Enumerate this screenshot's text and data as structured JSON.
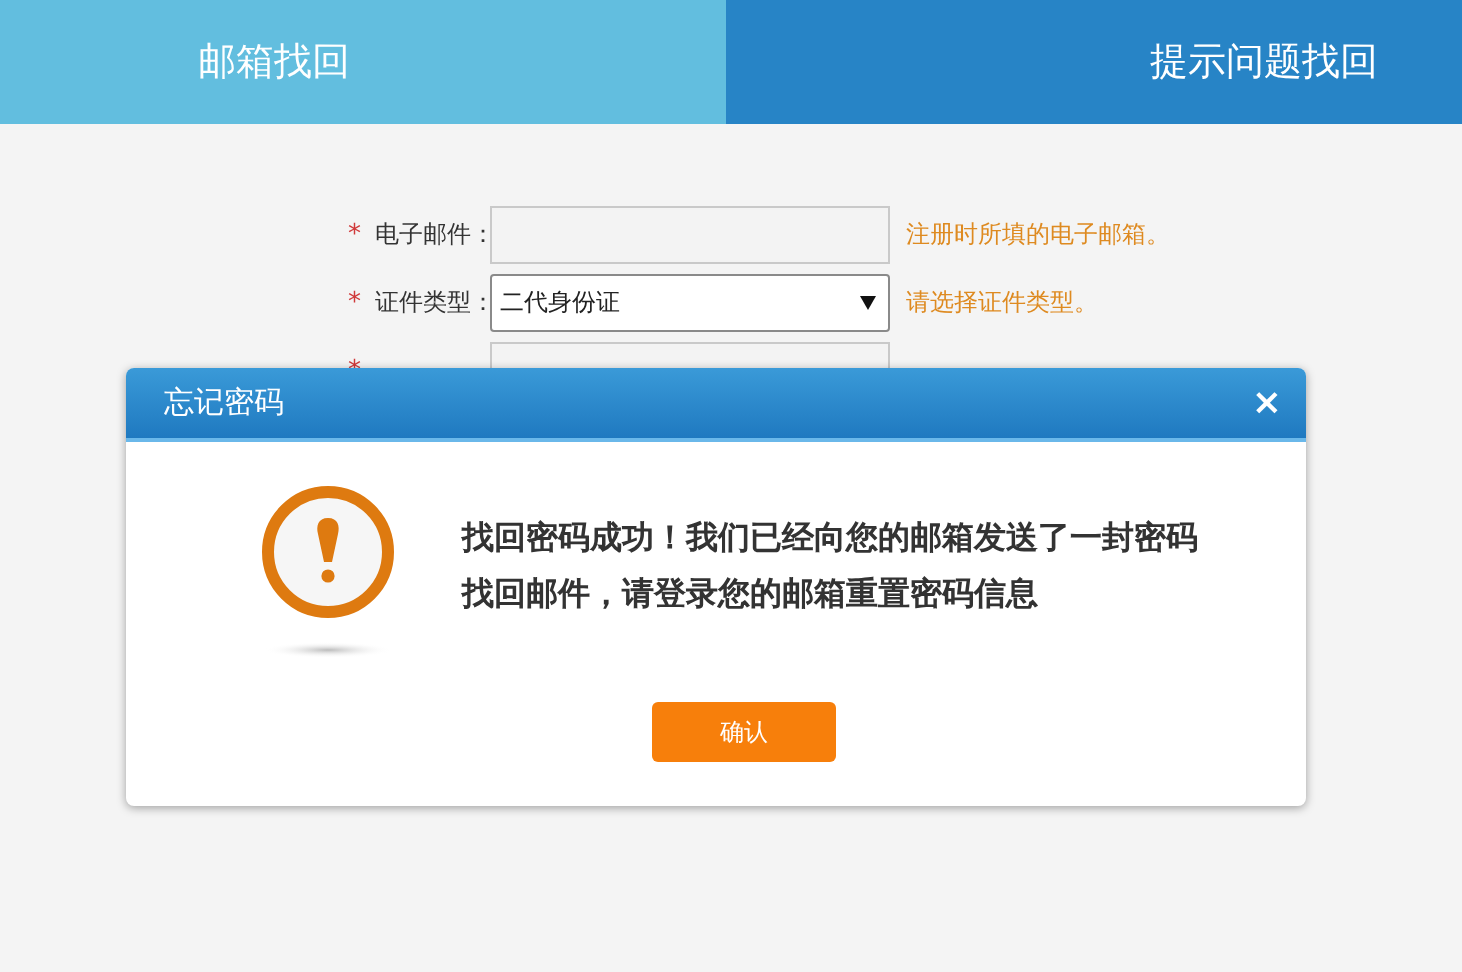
{
  "tabs": [
    {
      "label": "邮箱找回",
      "selected": true
    },
    {
      "label": "提示问题找回",
      "selected": false
    }
  ],
  "form": {
    "fields": [
      {
        "kind": "text",
        "label": "电子邮件：",
        "required_mark": "*",
        "hint": "注册时所填的电子邮箱。"
      },
      {
        "kind": "select",
        "label": "证件类型：",
        "required_mark": "*",
        "value": "二代身份证",
        "hint": "请选择证件类型。"
      },
      {
        "kind": "text",
        "required_mark": "*"
      }
    ]
  },
  "dialog": {
    "title": "忘记密码",
    "close": "×",
    "message": "找回密码成功！我们已经向您的邮箱发送了一封密码找回邮件，请登录您的邮箱重置密码信息",
    "button": "确认"
  }
}
